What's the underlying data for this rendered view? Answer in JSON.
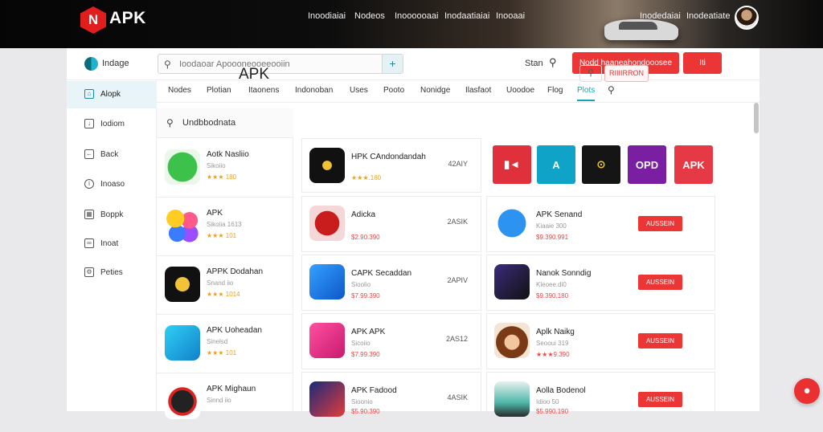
{
  "top": {
    "logo_text": "APK",
    "nav": [
      "Inoodiaiai",
      "Nodeos",
      "Inoooooaai",
      "Inodaatiaiai",
      "Inooaai"
    ],
    "right_nav": [
      "Inodedaiai",
      "Inodeatiate"
    ]
  },
  "header": {
    "brand": "Indage",
    "search_placeholder": "Ioodaoar Apoooneooeeooiin",
    "user_label": "Stan",
    "primary_button": "Nodd haaneahondooosee",
    "secondary_button": "Iti"
  },
  "tabs": [
    "Nodes",
    "Plotian",
    "Itaonens",
    "Indonoban",
    "Uses",
    "Pooto",
    "Nonidge",
    "Ilasfaot",
    "Uoodoe",
    "Flog",
    "Plots"
  ],
  "sidebar": [
    {
      "label": "Alopk",
      "icon": "home-icon"
    },
    {
      "label": "Iodiom",
      "icon": "download-icon"
    },
    {
      "label": "Back",
      "icon": "back-icon"
    },
    {
      "label": "Inoaso",
      "icon": "info-icon"
    },
    {
      "label": "Boppk",
      "icon": "calendar-icon"
    },
    {
      "label": "Inoat",
      "icon": "link-icon"
    },
    {
      "label": "Peties",
      "icon": "settings-icon"
    }
  ],
  "list": {
    "search_text": "Undbbodnata",
    "items": [
      {
        "name": "Aotk Nasliio",
        "sub": "Sikoiio",
        "rating": "★★★ 180"
      },
      {
        "name": "APK",
        "sub": "Sikoiia 1613",
        "rating": "★★★ 101"
      },
      {
        "name": "APPK Dodahan",
        "sub": "Snand iio",
        "rating": "★★★ 1014"
      },
      {
        "name": "APK Uoheadan",
        "sub": "Sinelsd",
        "rating": "★★★ 101"
      },
      {
        "name": "APK Mighaun",
        "sub": "Sinnd iio",
        "rating": ""
      }
    ]
  },
  "main": {
    "title": "APK",
    "mini_button": "RIIIIRRON",
    "cards": [
      {
        "name": "HPK CAndondandah",
        "sub": "Sknnioii",
        "price": "★★★.160",
        "size": "42AIY",
        "icon": "i-black-gold"
      },
      {
        "name": "Adicka",
        "sub": "Siiioio",
        "price": "$2.90.390",
        "size": "2ASIK",
        "icon": "i-red-circle"
      },
      {
        "name": "APK Senand",
        "sub": "Kiaaie 300",
        "price": "$9.390.991",
        "action": "AUSSEIN",
        "icon": "i-skyblue"
      },
      {
        "name": "CAPK Secaddan",
        "sub": "Sioolio",
        "price": "$7.99.390",
        "size": "2APIV",
        "icon": "i-blue"
      },
      {
        "name": "Nanok Sonndig",
        "sub": "Kleoee.di0",
        "price": "$9.390.180",
        "action": "AUSSEIN",
        "icon": "i-purpleblk"
      },
      {
        "name": "APK APK",
        "sub": "Sicoiio",
        "price": "$7.99.390",
        "size": "2AS12",
        "icon": "i-pink"
      },
      {
        "name": "Aplk Naikg",
        "sub": "Seooui 319",
        "price": "★★★9.390",
        "action": "AUSSEIN",
        "icon": "i-monkey"
      },
      {
        "name": "APK Fadood",
        "sub": "Sioonio",
        "price": "$5.90.390",
        "size": "4ASIK",
        "icon": "i-navy"
      },
      {
        "name": "Aolla Bodenol",
        "sub": "Idioo 50",
        "price": "$5.990.190",
        "action": "AUSSEIN",
        "icon": "i-trash"
      }
    ],
    "tiles": [
      {
        "label": "▮◄",
        "color": "#e0303b"
      },
      {
        "label": "A",
        "color": "#0fa3c7"
      },
      {
        "label": "⊙",
        "color": "#151515"
      },
      {
        "label": "OPD",
        "color": "#7b1fa2"
      },
      {
        "label": "APK",
        "color": "#e53945"
      }
    ]
  }
}
